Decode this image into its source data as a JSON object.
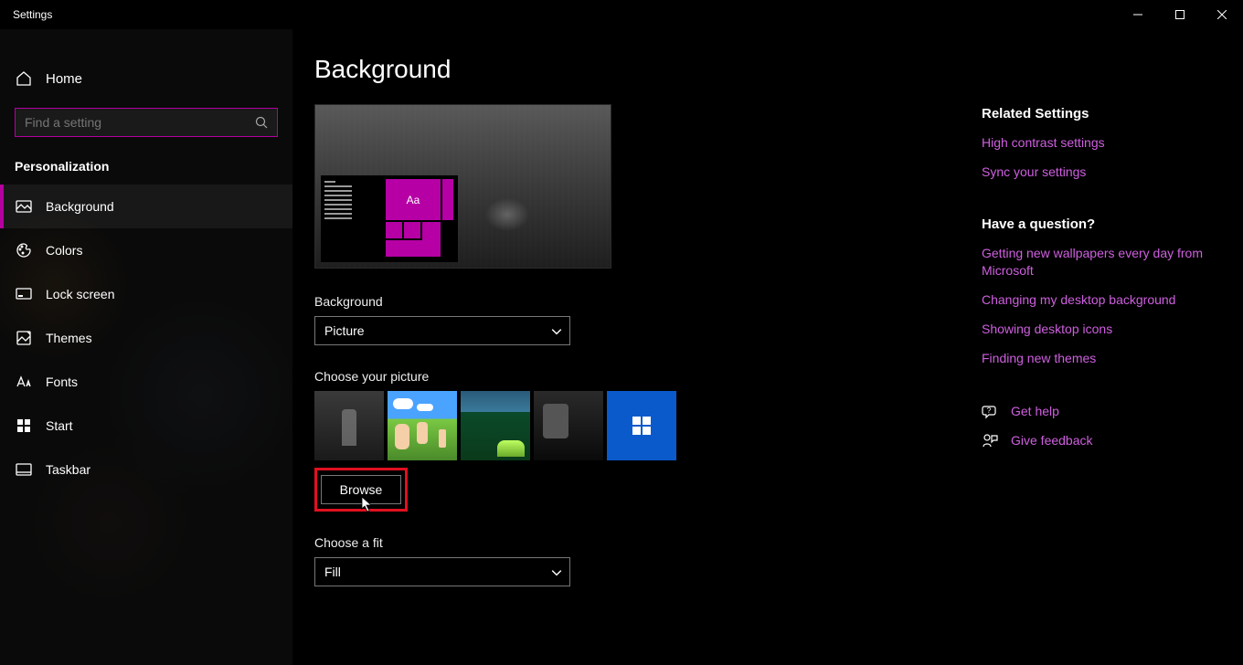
{
  "window": {
    "title": "Settings"
  },
  "sidebar": {
    "home": "Home",
    "search_placeholder": "Find a setting",
    "section": "Personalization",
    "items": [
      {
        "label": "Background",
        "active": true
      },
      {
        "label": "Colors"
      },
      {
        "label": "Lock screen"
      },
      {
        "label": "Themes"
      },
      {
        "label": "Fonts"
      },
      {
        "label": "Start"
      },
      {
        "label": "Taskbar"
      }
    ]
  },
  "main": {
    "title": "Background",
    "preview_tile_label": "Aa",
    "bg_label": "Background",
    "bg_value": "Picture",
    "choose_picture_label": "Choose your picture",
    "browse_label": "Browse",
    "fit_label": "Choose a fit",
    "fit_value": "Fill"
  },
  "related": {
    "heading": "Related Settings",
    "links": [
      "High contrast settings",
      "Sync your settings"
    ]
  },
  "question": {
    "heading": "Have a question?",
    "links": [
      "Getting new wallpapers every day from Microsoft",
      "Changing my desktop background",
      "Showing desktop icons",
      "Finding new themes"
    ]
  },
  "help": {
    "get_help": "Get help",
    "feedback": "Give feedback"
  }
}
